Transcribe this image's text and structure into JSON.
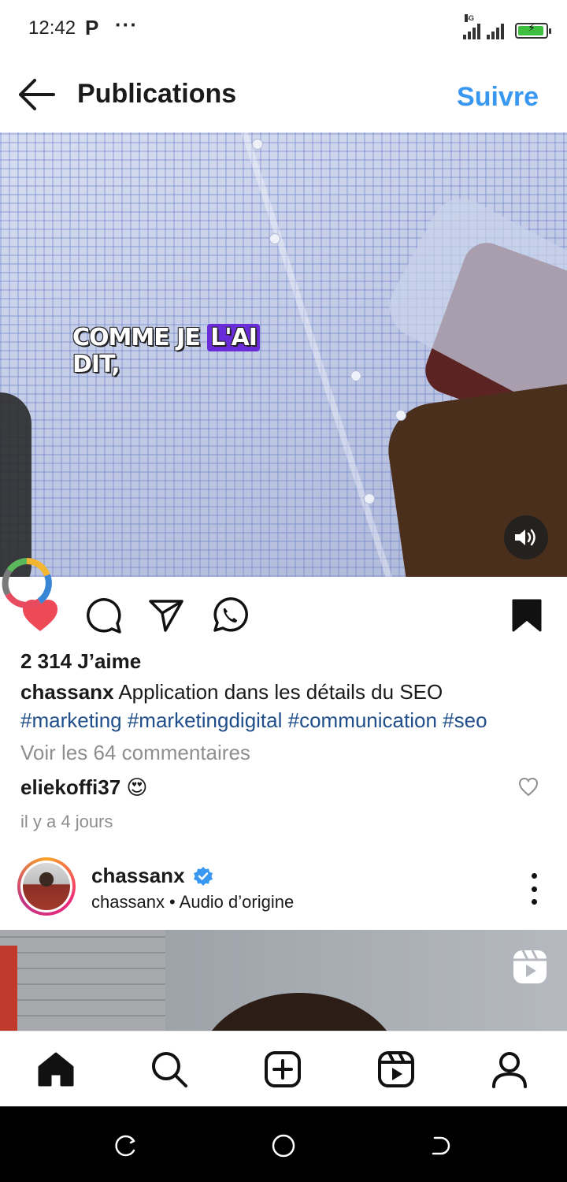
{
  "status_bar": {
    "time": "12:42",
    "notification_icon": "P",
    "more": "···",
    "network": "4G",
    "battery_level": 0.85,
    "battery_color": "#3fbf3f"
  },
  "header": {
    "title": "Publications",
    "follow_label": "Suivre",
    "accent": "#3897f0"
  },
  "post": {
    "video_caption_words": [
      "COMME JE",
      "L'AI",
      "DIT,"
    ],
    "likes": "2 314 J’aime",
    "author": "chassanx",
    "caption_text": " Application dans les détails du SEO",
    "hashtags": "#marketing #marketingdigital #communication #seo",
    "view_comments": "Voir les 64 commentaires",
    "comment_user": "eliekoffi37",
    "comment_emoji": "😍",
    "time_ago": "il y a 4 jours",
    "liked": true,
    "saved": true,
    "like_color": "#ed4956"
  },
  "next_post": {
    "username": "chassanx",
    "subtitle": "chassanx • Audio d’origine",
    "verified_color": "#3897f0"
  },
  "bottom_nav": {
    "items": [
      "home-icon",
      "search-icon",
      "create-icon",
      "reels-icon",
      "profile-icon"
    ]
  }
}
